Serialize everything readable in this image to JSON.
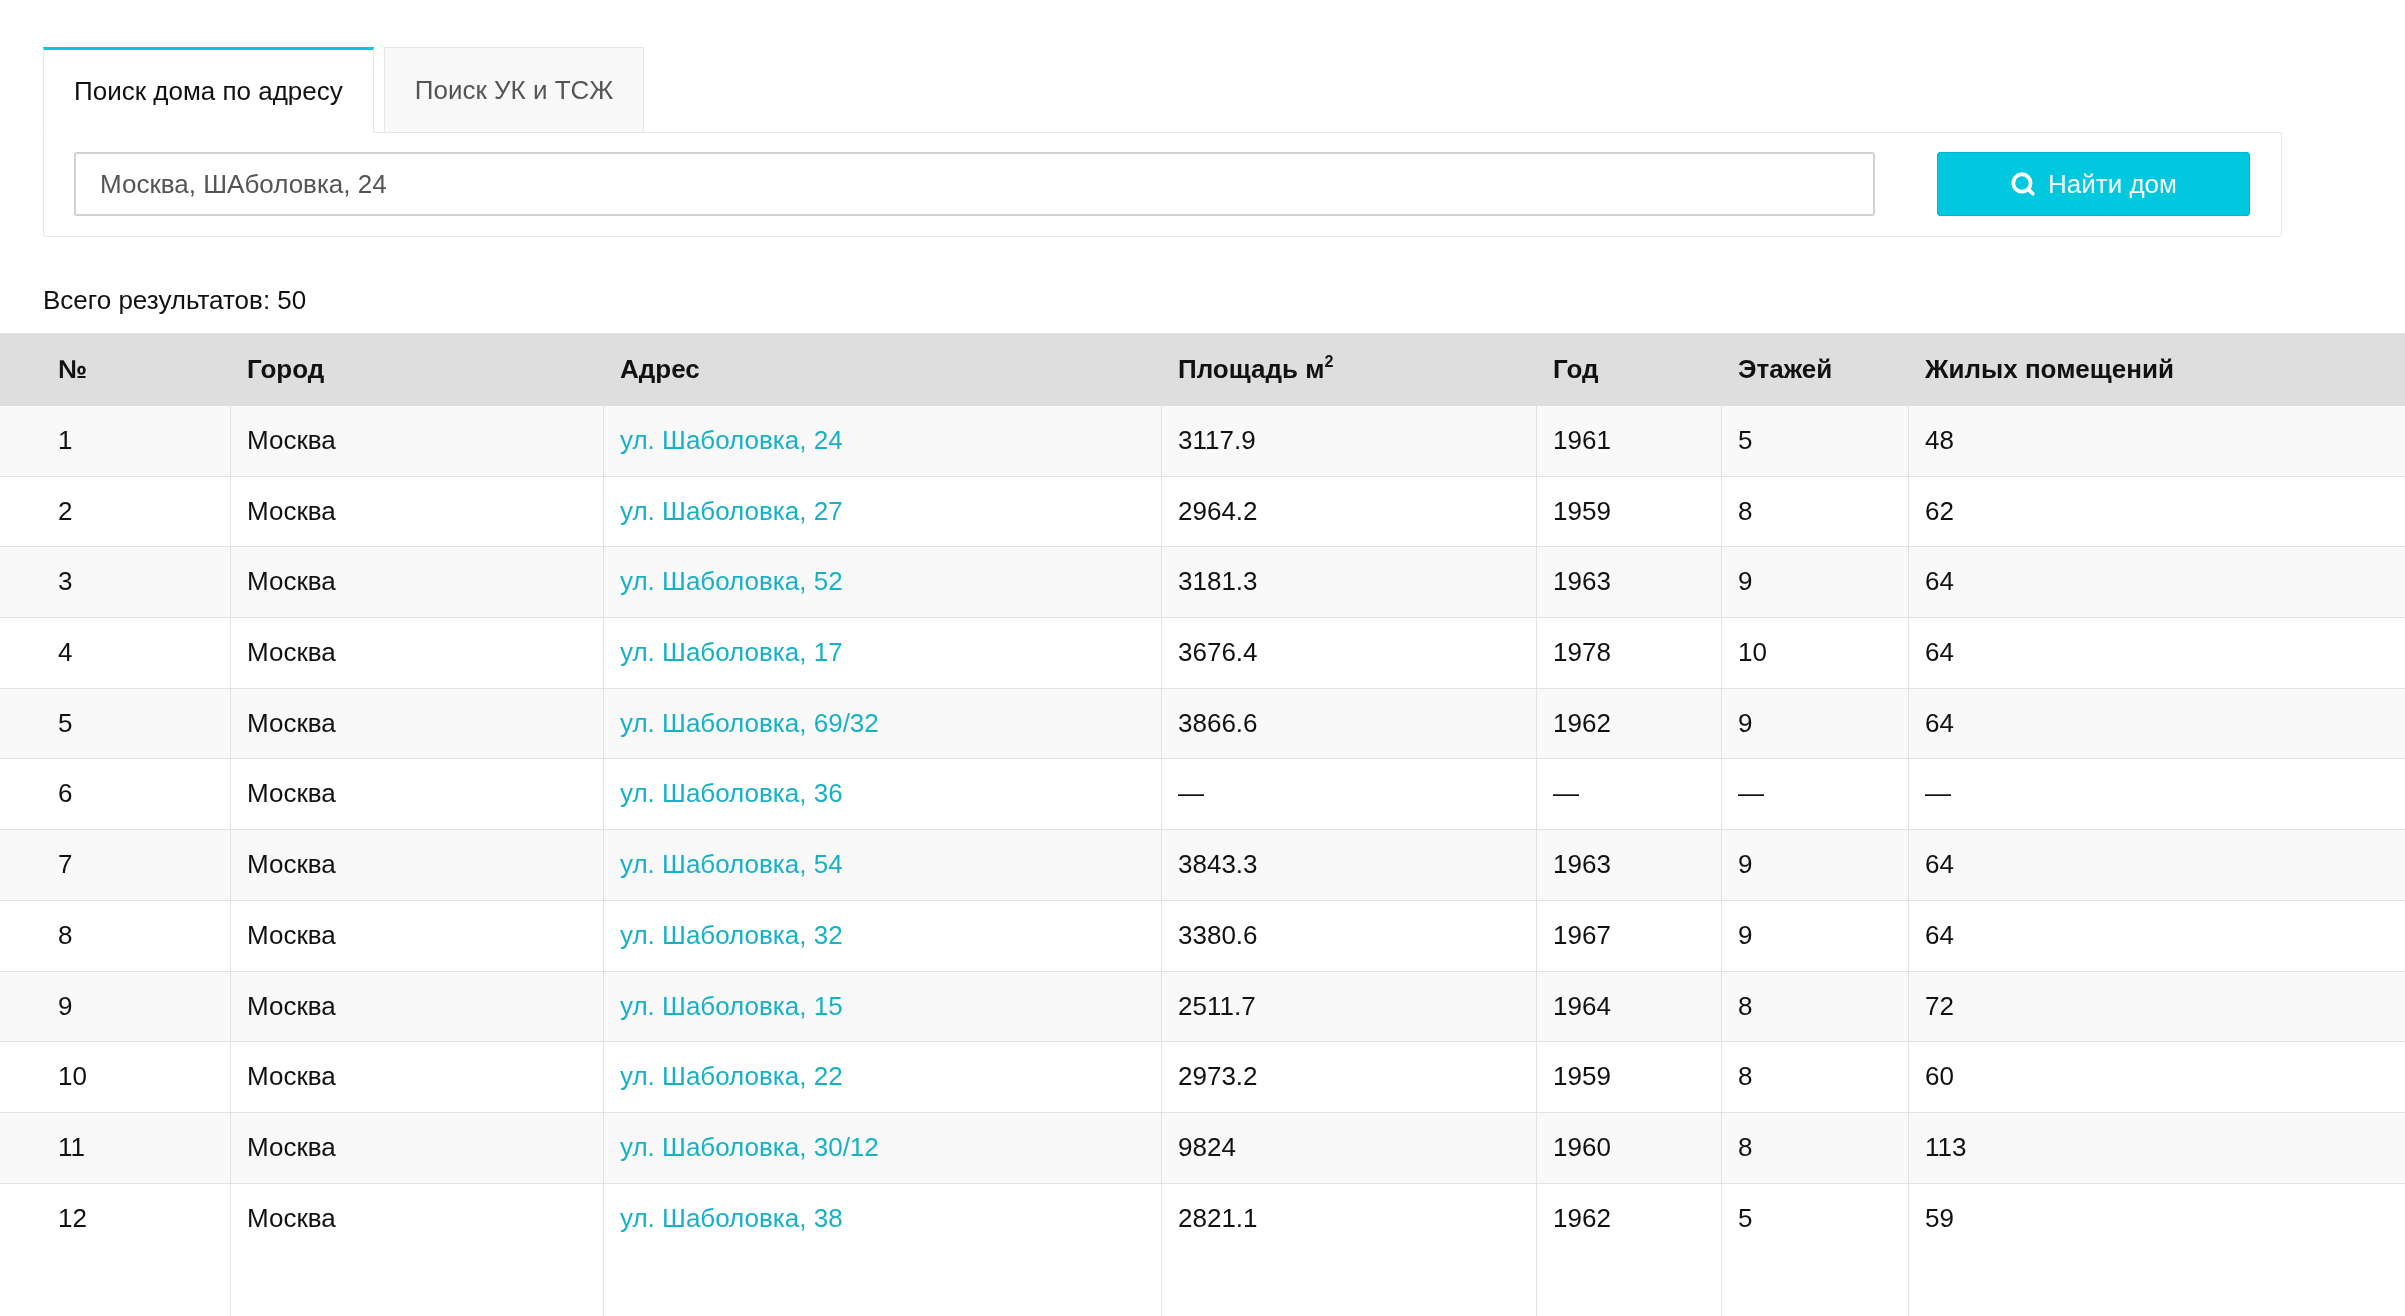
{
  "tabs": [
    {
      "label": "Поиск дома по адресу",
      "selected": true
    },
    {
      "label": "Поиск УК и ТСЖ",
      "selected": false
    }
  ],
  "search": {
    "value": "Москва, ШАболовка, 24",
    "button": "Найти дом"
  },
  "results_total": "Всего результатов: 50",
  "table": {
    "columns": [
      {
        "label": "№",
        "kind": "text"
      },
      {
        "label": "Город",
        "kind": "text"
      },
      {
        "label": "Адрес",
        "kind": "link"
      },
      {
        "label": "Площадь м$^{2}$",
        "kind": "text"
      },
      {
        "label": "Год",
        "kind": "text"
      },
      {
        "label": "Этажей",
        "kind": "text"
      },
      {
        "label": "Жилых помещений",
        "kind": "text"
      }
    ],
    "rows": [
      [
        "1",
        "Москва",
        "ул. Шаболовка, 24",
        "3117.9",
        "1961",
        "5",
        "48"
      ],
      [
        "2",
        "Москва",
        "ул. Шаболовка, 27",
        "2964.2",
        "1959",
        "8",
        "62"
      ],
      [
        "3",
        "Москва",
        "ул. Шаболовка, 52",
        "3181.3",
        "1963",
        "9",
        "64"
      ],
      [
        "4",
        "Москва",
        "ул. Шаболовка, 17",
        "3676.4",
        "1978",
        "10",
        "64"
      ],
      [
        "5",
        "Москва",
        "ул. Шаболовка, 69/32",
        "3866.6",
        "1962",
        "9",
        "64"
      ],
      [
        "6",
        "Москва",
        "ул. Шаболовка, 36",
        "—",
        "—",
        "—",
        "—"
      ],
      [
        "7",
        "Москва",
        "ул. Шаболовка, 54",
        "3843.3",
        "1963",
        "9",
        "64"
      ],
      [
        "8",
        "Москва",
        "ул. Шаболовка, 32",
        "3380.6",
        "1967",
        "9",
        "64"
      ],
      [
        "9",
        "Москва",
        "ул. Шаболовка, 15",
        "2511.7",
        "1964",
        "8",
        "72"
      ],
      [
        "10",
        "Москва",
        "ул. Шаболовка, 22",
        "2973.2",
        "1959",
        "8",
        "60"
      ],
      [
        "11",
        "Москва",
        "ул. Шаболовка, 30/12",
        "9824",
        "1960",
        "8",
        "113"
      ],
      [
        "12",
        "Москва",
        "ул. Шаболовка, 38",
        "2821.1",
        "1962",
        "5",
        "59"
      ]
    ]
  }
}
